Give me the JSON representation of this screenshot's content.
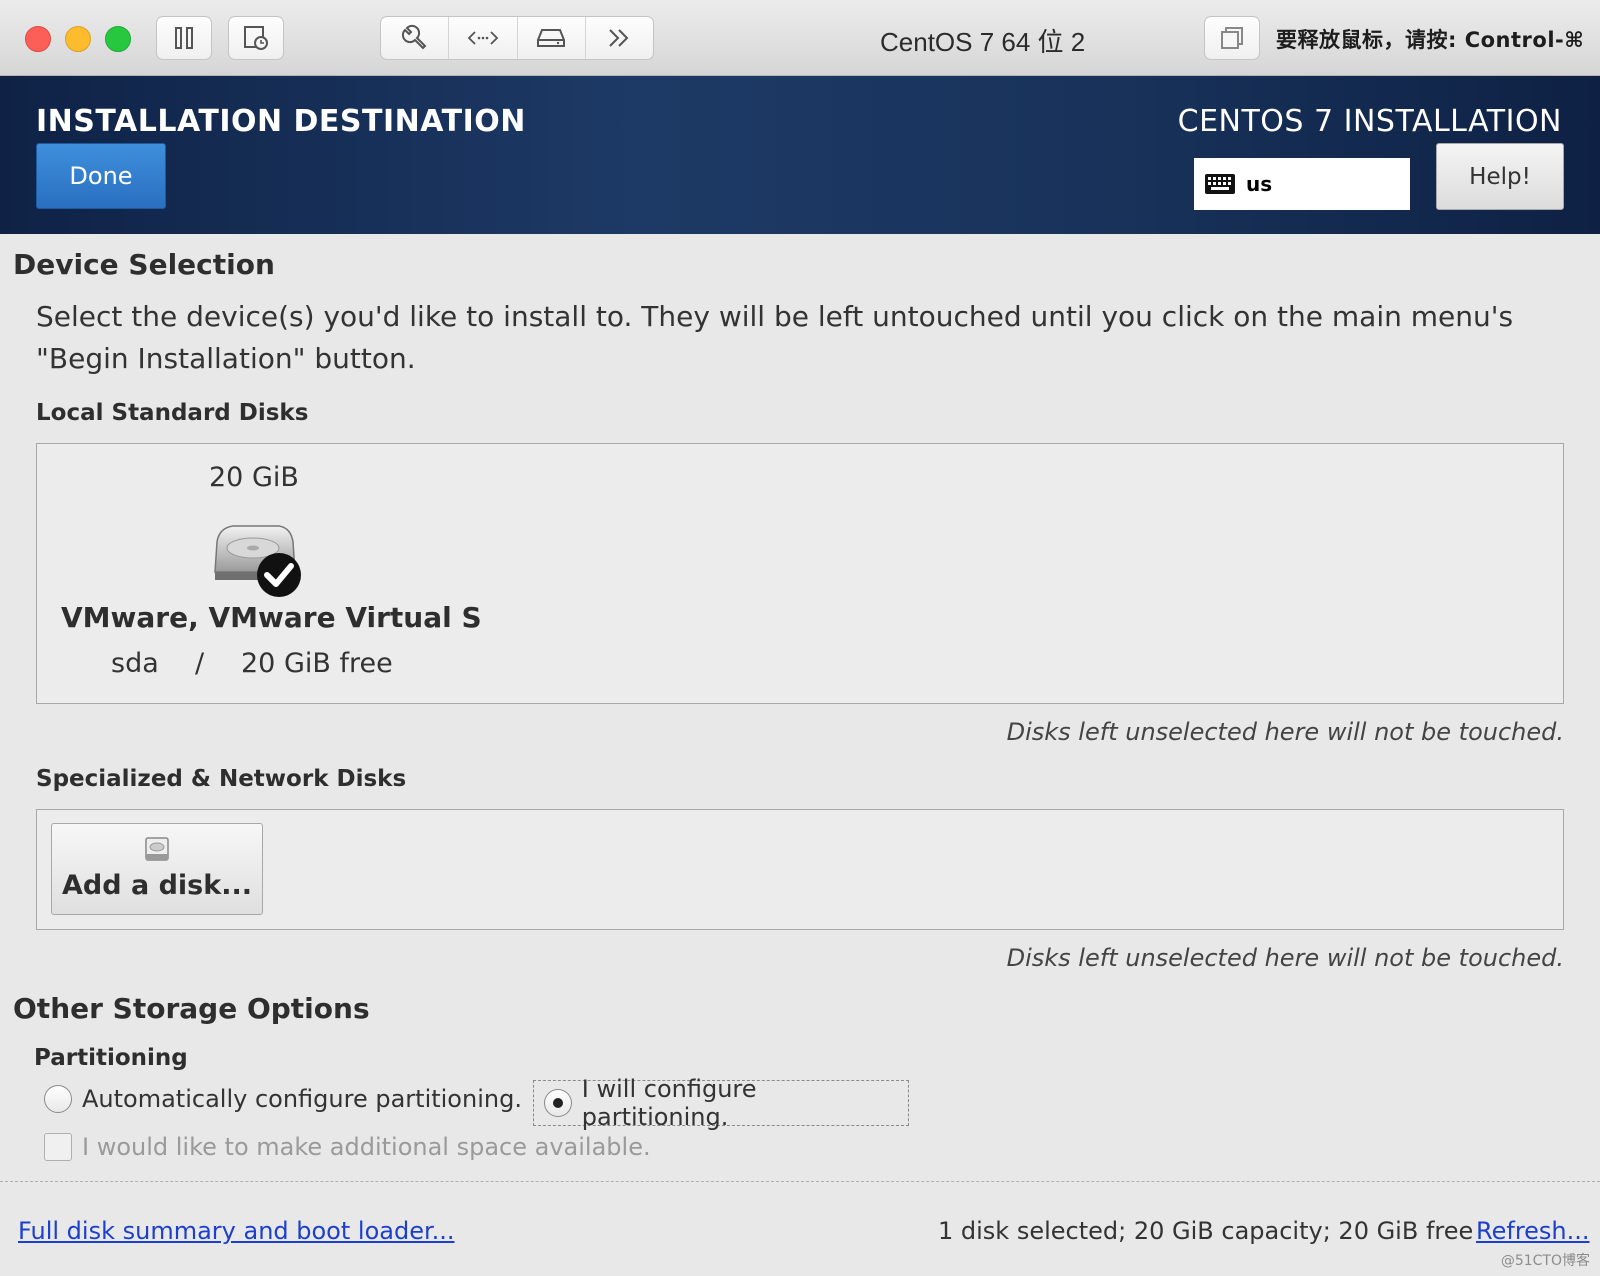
{
  "window": {
    "title": "CentOS 7 64 位 2",
    "release_hint": "要释放鼠标，请按: Control-⌘"
  },
  "header": {
    "title": "INSTALLATION DESTINATION",
    "done_label": "Done",
    "product_title": "CENTOS 7 INSTALLATION",
    "keyboard_layout": "us",
    "help_label": "Help!"
  },
  "device_selection": {
    "title": "Device Selection",
    "description": "Select the device(s) you'd like to install to.  They will be left untouched until you click on the main menu's \"Begin Installation\" button.",
    "local_disks_title": "Local Standard Disks",
    "disks": [
      {
        "size": "20 GiB",
        "name": "VMware, VMware Virtual S",
        "device": "sda",
        "separator": "/",
        "free": "20 GiB free",
        "selected": true
      }
    ],
    "local_hint": "Disks left unselected here will not be touched.",
    "network_disks_title": "Specialized & Network Disks",
    "add_disk_label": "Add a disk...",
    "network_hint": "Disks left unselected here will not be touched."
  },
  "other_storage": {
    "title": "Other Storage Options",
    "partitioning_title": "Partitioning",
    "auto_label": "Automatically configure partitioning.",
    "manual_label": "I will configure partitioning.",
    "selected": "manual",
    "space_label": "I would like to make additional space available."
  },
  "footer": {
    "summary_link": "Full disk summary and boot loader...",
    "summary_text": "1 disk selected; 20 GiB capacity; 20 GiB free",
    "refresh_link": "Refresh..."
  },
  "watermark": "@51CTO博客"
}
